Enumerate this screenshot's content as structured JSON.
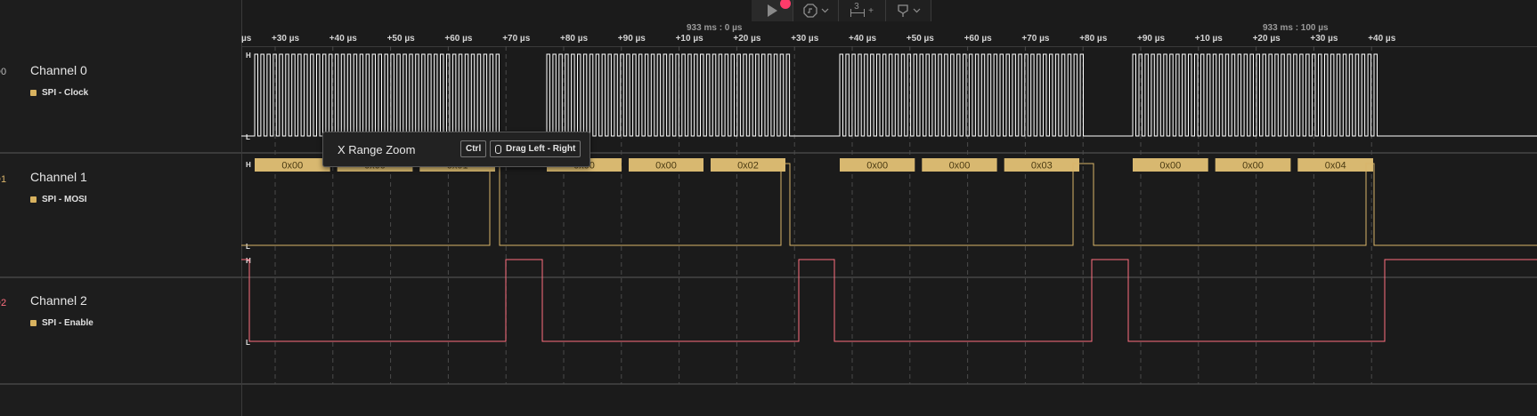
{
  "toolbar": {
    "play_icon": "play-icon",
    "record_icon": "record-indicator-icon",
    "trigger_icon": "trigger-icon",
    "measure_count": "3",
    "measure_add": "+",
    "marker_icon": "marker-icon",
    "chevron": "chevron-down-icon"
  },
  "ruler": {
    "reference_left": "933 ms : 0 µs",
    "reference_right": "933 ms : 100 µs",
    "ticks": [
      "µs",
      "+30 µs",
      "+40 µs",
      "+50 µs",
      "+60 µs",
      "+70 µs",
      "+80 µs",
      "+90 µs",
      "+10 µs",
      "+20 µs",
      "+30 µs",
      "+40 µs",
      "+50 µs",
      "+60 µs",
      "+70 µs",
      "+80 µs",
      "+90 µs",
      "+10 µs",
      "+20 µs",
      "+30 µs",
      "+40 µs"
    ]
  },
  "channels": [
    {
      "index": "D0",
      "name": "Channel 0",
      "analyzer": "SPI - Clock",
      "color": "#ffffff"
    },
    {
      "index": "D1",
      "name": "Channel 1",
      "analyzer": "SPI - MOSI",
      "color": "#d9b46a"
    },
    {
      "index": "D2",
      "name": "Channel 2",
      "analyzer": "SPI - Enable",
      "color": "#ff6f7f"
    }
  ],
  "level_labels": {
    "high": "H",
    "low": "L"
  },
  "decoded_bytes": [
    "0x00",
    "0x00",
    "0x01",
    "0x00",
    "0x00",
    "0x02",
    "0x00",
    "0x00",
    "0x03",
    "0x00",
    "0x00",
    "0x04"
  ],
  "tooltip": {
    "title": "X Range Zoom",
    "key": "Ctrl",
    "action": "Drag Left - Right",
    "mouse_icon": "mouse-icon"
  },
  "colors": {
    "background": "#1b1b1b",
    "decode_fill": "#d8b870",
    "clock": "#ffffff",
    "mosi": "#d9b46a",
    "enable": "#ff6f7f"
  }
}
